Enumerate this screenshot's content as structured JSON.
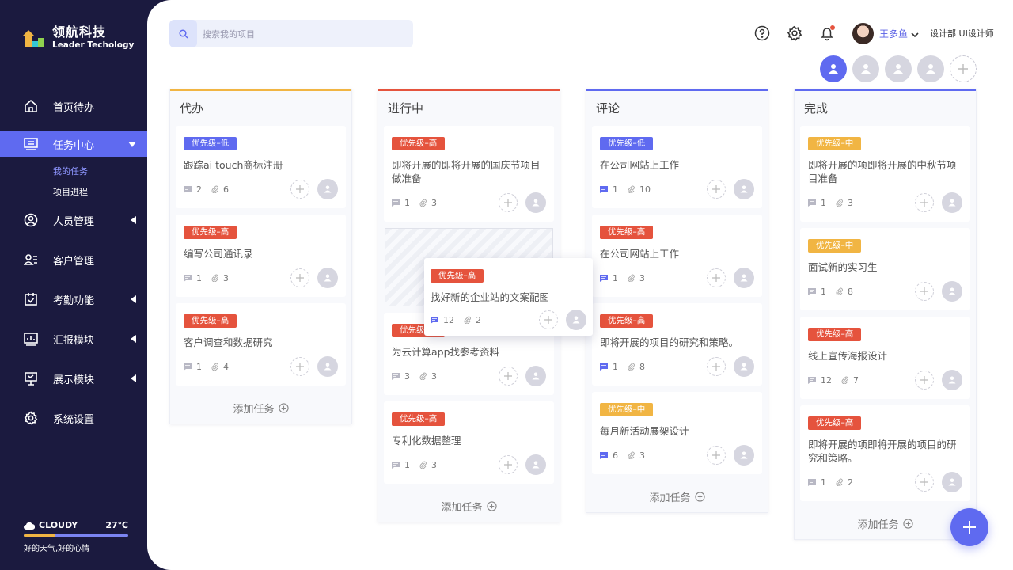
{
  "brand": {
    "name_cn": "领航科技",
    "name_en": "Leader Techology"
  },
  "nav": {
    "items": [
      {
        "label": "首页待办",
        "icon": "home-icon"
      },
      {
        "label": "任务中心",
        "icon": "monitor-icon",
        "active": true
      },
      {
        "label": "人员管理",
        "icon": "user-circle-icon"
      },
      {
        "label": "客户管理",
        "icon": "contacts-icon"
      },
      {
        "label": "考勤功能",
        "icon": "calendar-check-icon"
      },
      {
        "label": "汇报模块",
        "icon": "report-icon"
      },
      {
        "label": "展示模块",
        "icon": "presentation-icon"
      },
      {
        "label": "系统设置",
        "icon": "gear-icon"
      }
    ],
    "sub_items": [
      "我的任务",
      "项目进程"
    ]
  },
  "weather": {
    "condition": "CLOUDY",
    "temp": "27℃",
    "note": "好的天气,好的心情",
    "level": 0.3
  },
  "search": {
    "placeholder": "搜索我的项目"
  },
  "user": {
    "name": "王多鱼",
    "dept": "设计部 UI设计师"
  },
  "colors": {
    "accent": "#5f6af0",
    "low": "#5f6af0",
    "high": "#e5533d",
    "mid": "#f1b543",
    "sidebar": "#1b1a3f"
  },
  "board": {
    "add_label": "添加任务",
    "columns": [
      {
        "title": "代办",
        "bar_color": "#f1b543",
        "cards": [
          {
            "badge": "优先级–低",
            "level": "low",
            "title": "跟踪ai touch商标注册",
            "comments": "2",
            "files": "6"
          },
          {
            "badge": "优先级–高",
            "level": "high",
            "title": "编写公司通讯录",
            "comments": "1",
            "files": "3"
          },
          {
            "badge": "优先级–高",
            "level": "high",
            "title": "客户调查和数据研究",
            "comments": "1",
            "files": "4"
          }
        ]
      },
      {
        "title": "进行中",
        "bar_color": "#e5533d",
        "cards": [
          {
            "badge": "优先级–高",
            "level": "high",
            "title": "即将开展的即将开展的国庆节项目做准备",
            "comments": "1",
            "files": "3"
          },
          {
            "badge": "优先级–高",
            "level": "high",
            "title": "为云计算app找参考资料",
            "comments": "3",
            "files": "3"
          },
          {
            "badge": "优先级–高",
            "level": "high",
            "title": "专利化数据整理",
            "comments": "1",
            "files": "3"
          }
        ]
      },
      {
        "title": "评论",
        "bar_color": "#5f6af0",
        "cards": [
          {
            "badge": "优先级–低",
            "level": "low",
            "title": "在公司网站上工作",
            "comments": "1",
            "files": "10",
            "active_comment": true
          },
          {
            "badge": "优先级–高",
            "level": "high",
            "title": "在公司网站上工作",
            "comments": "1",
            "files": "3",
            "active_comment": true
          },
          {
            "badge": "优先级–高",
            "level": "high",
            "title": "即将开展的项目的研究和策略。",
            "comments": "1",
            "files": "8",
            "active_comment": true
          },
          {
            "badge": "优先级–中",
            "level": "mid",
            "title": "每月新活动展架设计",
            "comments": "6",
            "files": "3",
            "active_comment": true
          }
        ]
      },
      {
        "title": "完成",
        "bar_color": "#5f6af0",
        "cards": [
          {
            "badge": "优先级–中",
            "level": "mid",
            "title": "即将开展的项即将开展的中秋节项目准备",
            "comments": "1",
            "files": "3"
          },
          {
            "badge": "优先级–中",
            "level": "mid",
            "title": "面试新的实习生",
            "comments": "1",
            "files": "8"
          },
          {
            "badge": "优先级–高",
            "level": "high",
            "title": "线上宣传海报设计",
            "comments": "12",
            "files": "7"
          },
          {
            "badge": "优先级–高",
            "level": "high",
            "title": "即将开展的项即将开展的项目的研究和策略。",
            "comments": "1",
            "files": "2"
          }
        ]
      }
    ],
    "dragging": {
      "badge": "优先级–高",
      "level": "high",
      "title": "找好新的企业站的文案配图",
      "comments": "12",
      "files": "2"
    }
  }
}
